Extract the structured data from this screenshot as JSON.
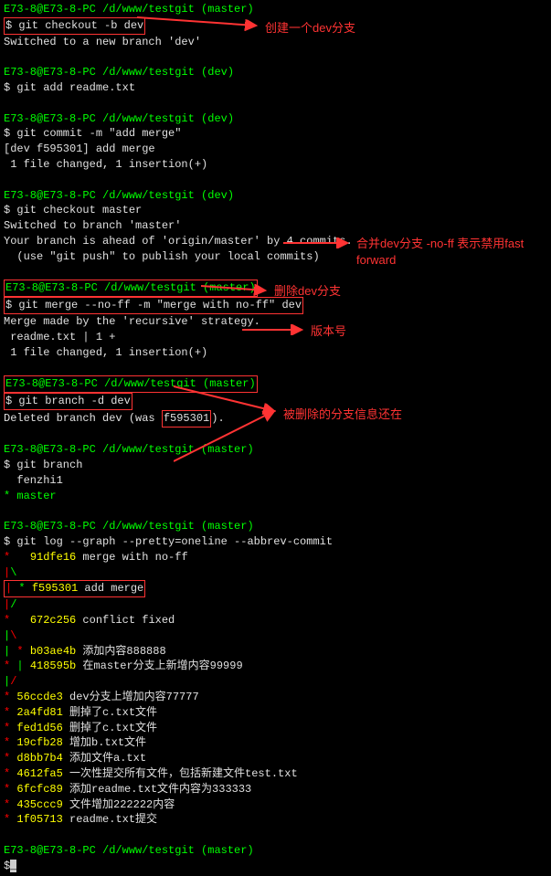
{
  "cursor": "_",
  "prompts": {
    "p_master": "E73-8@E73-8-PC /d/www/testgit (master)",
    "p_dev": "E73-8@E73-8-PC /d/www/testgit (dev)"
  },
  "lines": {
    "l1_prefix": "E73-8@E73-8-PC /d/www/testgit (master)",
    "l2_cmd": "git checkout -b dev",
    "l3": "Switched to a new branch 'dev'",
    "l5_cmd": "$ git add readme.txt",
    "l7_cmd": "$ git commit -m \"add merge\"",
    "l8": "[dev f595301] add merge",
    "l9": " 1 file changed, 1 insertion(+)",
    "l11_cmd": "$ git checkout master",
    "l12": "Switched to branch 'master'",
    "l13": "Your branch is ahead of 'origin/master' by 4 commits.",
    "l14": "  (use \"git push\" to publish your local commits)",
    "l16_cmd": "git merge --no-ff -m \"merge with no-ff\" dev",
    "l17": "Merge made by the 'recursive' strategy.",
    "l18": " readme.txt | 1 +",
    "l19": " 1 file changed, 1 insertion(+)",
    "l21_cmd": "git branch -d dev",
    "l22_a": "Deleted branch dev (was ",
    "l22_b": "f595301",
    "l22_c": ").",
    "l24_cmd": "$ git branch",
    "l25": "  fenzhi1",
    "l26": "* master",
    "l28_cmd": "$ git log --graph --pretty=oneline --abbrev-commit",
    "graph_star": "*",
    "graph_pipe": "|",
    "graph_slash": "/",
    "graph_bslash": "\\",
    "graph_pipestar": "| *",
    "log1_hash": "91dfe16",
    "log1_msg": " merge with no-ff",
    "log2_hash": "f595301",
    "log2_msg": " add merge",
    "log3_hash": "672c256",
    "log3_msg": " conflict fixed",
    "log4_hash": "b03ae4b",
    "log4_msg": " 添加内容888888",
    "log5_hash": "418595b",
    "log5_msg": " 在master分支上新增内容99999",
    "log6_hash": "56ccde3",
    "log6_msg": " dev分支上增加内容77777",
    "log7_hash": "2a4fd81",
    "log7_msg": " 删掉了c.txt文件",
    "log8_hash": "fed1d56",
    "log8_msg": " 删掉了c.txt文件",
    "log9_hash": "19cfb28",
    "log9_msg": " 增加b.txt文件",
    "log10_hash": "d8bb7b4",
    "log10_msg": " 添加文件a.txt",
    "log11_hash": "4612fa5",
    "log11_msg": " 一次性提交所有文件，包括新建文件test.txt",
    "log12_hash": "6fcfc89",
    "log12_msg": " 添加readme.txt文件内容为333333",
    "log13_hash": "435ccc9",
    "log13_msg": " 文件增加222222内容",
    "log14_hash": "1f05713",
    "log14_msg": " readme.txt提交",
    "dollar": "$",
    "dollar_sp": "$ "
  },
  "annotations": {
    "a1": "创建一个dev分支",
    "a2": "合并dev分支 -no-ff 表示禁用fast forward",
    "a3": "删除dev分支",
    "a4": "版本号",
    "a5": "被删除的分支信息还在"
  }
}
